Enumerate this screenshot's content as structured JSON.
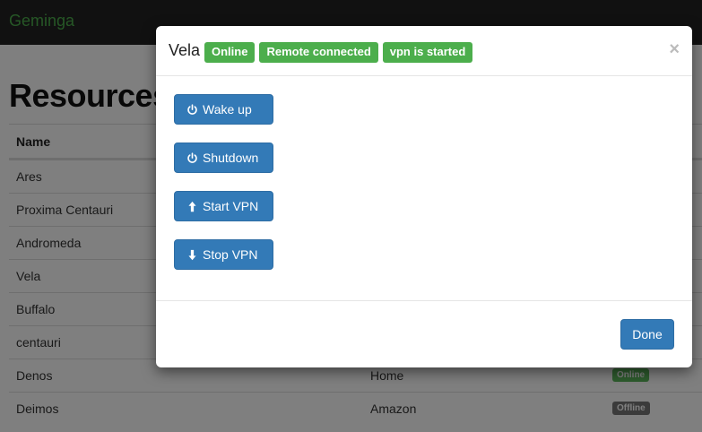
{
  "navbar": {
    "brand": "Geminga"
  },
  "page": {
    "title": "Resources",
    "table": {
      "headers": {
        "name": "Name"
      },
      "rows": [
        {
          "name": "Ares",
          "location": "",
          "status": ""
        },
        {
          "name": "Proxima Centauri",
          "location": "",
          "status": ""
        },
        {
          "name": "Andromeda",
          "location": "",
          "status": ""
        },
        {
          "name": "Vela",
          "location": "",
          "status": ""
        },
        {
          "name": "Buffalo",
          "location": "",
          "status": ""
        },
        {
          "name": "centauri",
          "location": "",
          "status": ""
        },
        {
          "name": "Denos",
          "location": "Home",
          "status": "Online"
        },
        {
          "name": "Deimos",
          "location": "Amazon",
          "status": "Offline"
        }
      ]
    }
  },
  "modal": {
    "title": "Vela",
    "badges": [
      "Online",
      "Remote connected",
      "vpn is started"
    ],
    "close": "×",
    "buttons": {
      "wake_up": {
        "label": "Wake up",
        "icon": "power-icon"
      },
      "shutdown": {
        "label": "Shutdown",
        "icon": "power-icon"
      },
      "start_vpn": {
        "label": "Start VPN",
        "icon": "arrow-up-icon"
      },
      "stop_vpn": {
        "label": "Stop VPN",
        "icon": "arrow-down-icon"
      }
    },
    "done": "Done"
  },
  "colors": {
    "navbar_bg": "#222222",
    "brand": "#4cae4c",
    "badge_green": "#4cae4c",
    "primary_button": "#337ab7",
    "status_online": "#5cb85c",
    "status_offline": "#777777"
  }
}
